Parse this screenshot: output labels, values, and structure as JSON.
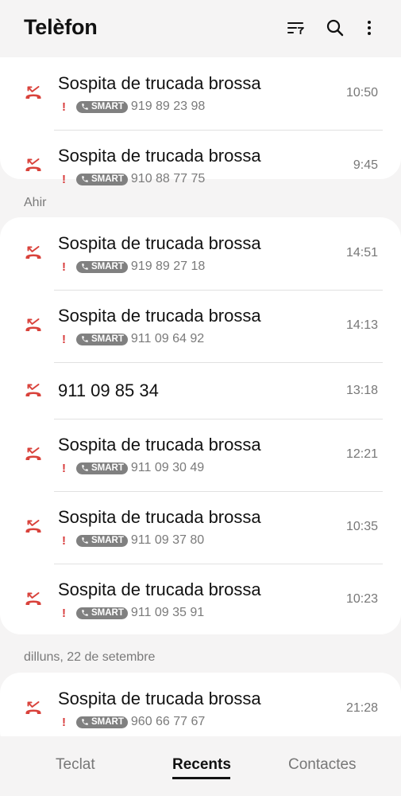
{
  "header": {
    "title": "Telèfon",
    "icons": [
      "filter-icon",
      "search-icon",
      "more-options-icon"
    ]
  },
  "colors": {
    "missed_call": "#d9423b",
    "badge_bg": "#808080",
    "card_bg": "#ffffff",
    "page_bg": "#f5f4f4"
  },
  "badge_label": "SMART",
  "sections": [
    {
      "label": "",
      "rows": [
        {
          "name": "Sospita de trucada brossa",
          "number": "919 89 23 98",
          "time": "10:50"
        },
        {
          "name": "Sospita de trucada brossa",
          "number": "910 88 77 75",
          "time": "9:45"
        }
      ]
    },
    {
      "label": "Ahir",
      "rows": [
        {
          "name": "Sospita de trucada brossa",
          "number": "919 89 27 18",
          "time": "14:51"
        },
        {
          "name": "Sospita de trucada brossa",
          "number": "911 09 64 92",
          "time": "14:13"
        },
        {
          "name": "911 09 85 34",
          "number": "",
          "time": "13:18"
        },
        {
          "name": "Sospita de trucada brossa",
          "number": "911 09 30 49",
          "time": "12:21"
        },
        {
          "name": "Sospita de trucada brossa",
          "number": "911 09 37 80",
          "time": "10:35"
        },
        {
          "name": "Sospita de trucada brossa",
          "number": "911 09 35 91",
          "time": "10:23"
        }
      ]
    },
    {
      "label": "dilluns, 22 de setembre",
      "rows": [
        {
          "name": "Sospita de trucada brossa",
          "number": "960 66 77 67",
          "time": "21:28"
        }
      ]
    }
  ],
  "bottom_nav": {
    "tabs": [
      "Teclat",
      "Recents",
      "Contactes"
    ],
    "active": "Recents"
  }
}
